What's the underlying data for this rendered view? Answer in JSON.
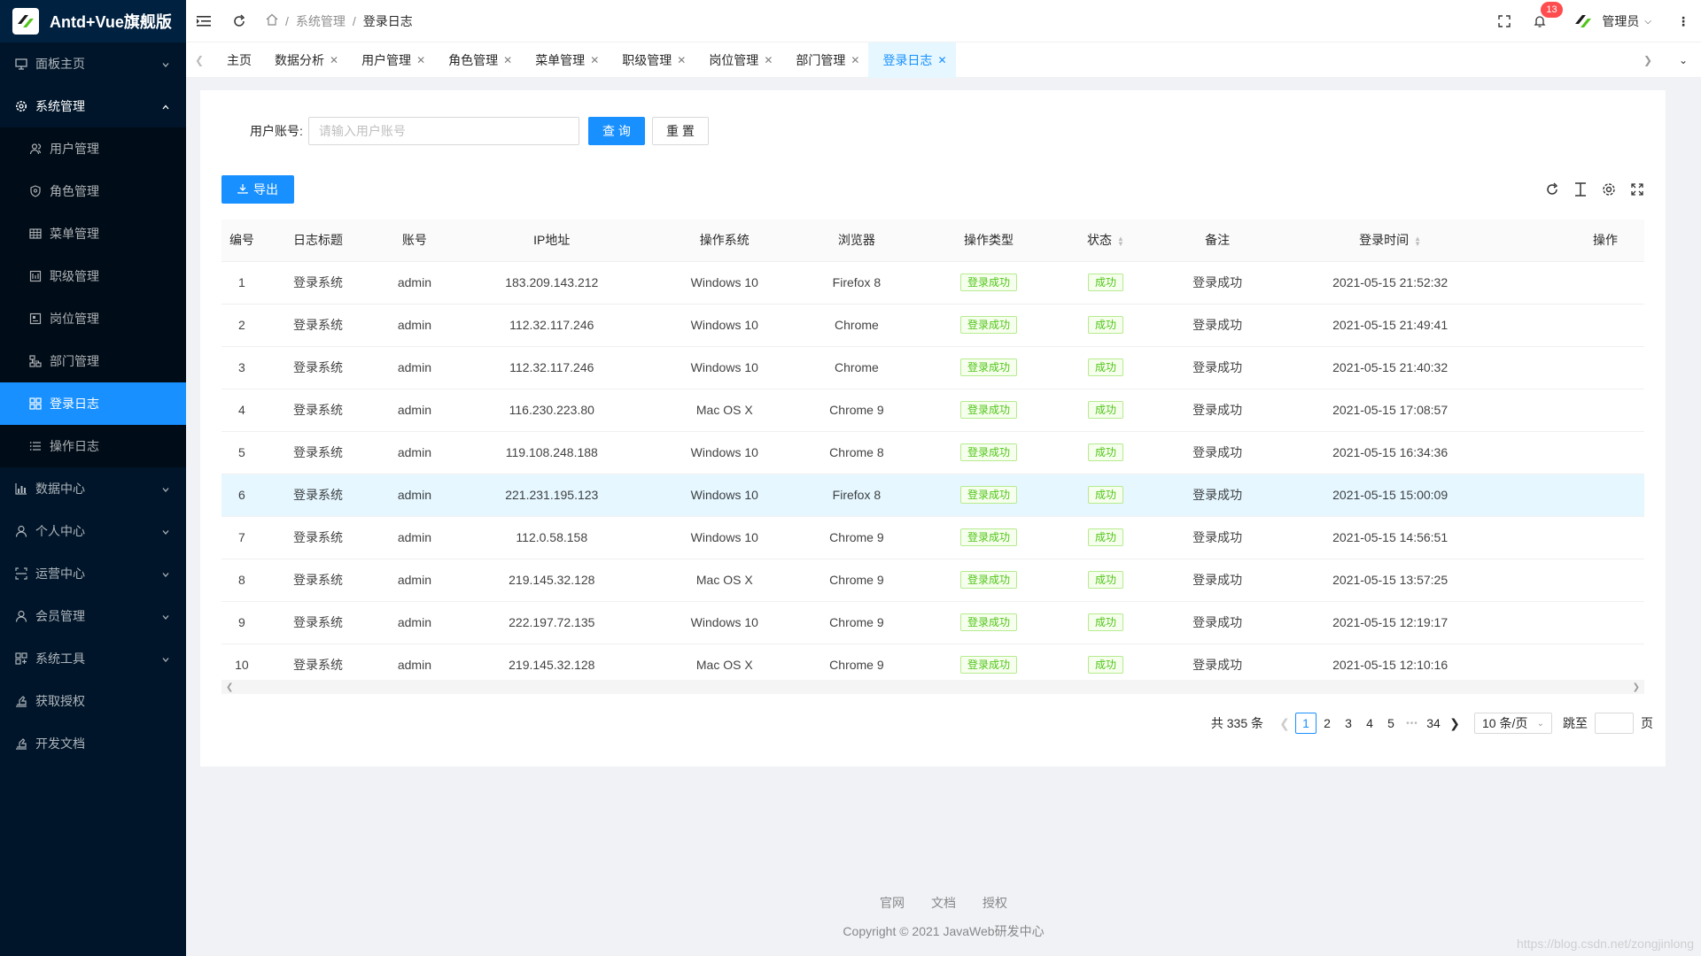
{
  "app": {
    "title": "Antd+Vue旗舰版"
  },
  "sidebar": {
    "items": [
      {
        "label": "面板主页",
        "icon": "monitor-icon",
        "has_children": true
      },
      {
        "label": "系统管理",
        "icon": "gear-icon",
        "has_children": true,
        "open": true,
        "children": [
          {
            "label": "用户管理",
            "icon": "user-group-icon"
          },
          {
            "label": "角色管理",
            "icon": "shield-icon"
          },
          {
            "label": "菜单管理",
            "icon": "grid-icon"
          },
          {
            "label": "职级管理",
            "icon": "rank-icon"
          },
          {
            "label": "岗位管理",
            "icon": "post-icon"
          },
          {
            "label": "部门管理",
            "icon": "org-icon"
          },
          {
            "label": "登录日志",
            "icon": "app-grid-icon",
            "active": true
          },
          {
            "label": "操作日志",
            "icon": "list-icon"
          }
        ]
      },
      {
        "label": "数据中心",
        "icon": "chart-icon",
        "has_children": true
      },
      {
        "label": "个人中心",
        "icon": "person-icon",
        "has_children": true
      },
      {
        "label": "运营中心",
        "icon": "scan-icon",
        "has_children": true
      },
      {
        "label": "会员管理",
        "icon": "member-icon",
        "has_children": true
      },
      {
        "label": "系统工具",
        "icon": "tools-icon",
        "has_children": true
      },
      {
        "label": "获取授权",
        "icon": "auth-icon",
        "has_children": false
      },
      {
        "label": "开发文档",
        "icon": "doc-icon",
        "has_children": false
      }
    ]
  },
  "header": {
    "breadcrumb": [
      "系统管理",
      "登录日志"
    ],
    "notification_count": "13",
    "user_name": "管理员"
  },
  "tabs": [
    {
      "label": "主页",
      "closable": false
    },
    {
      "label": "数据分析",
      "closable": true
    },
    {
      "label": "用户管理",
      "closable": true
    },
    {
      "label": "角色管理",
      "closable": true
    },
    {
      "label": "菜单管理",
      "closable": true
    },
    {
      "label": "职级管理",
      "closable": true
    },
    {
      "label": "岗位管理",
      "closable": true
    },
    {
      "label": "部门管理",
      "closable": true
    },
    {
      "label": "登录日志",
      "closable": true,
      "active": true
    }
  ],
  "search": {
    "label": "用户账号:",
    "placeholder": "请输入用户账号",
    "query_label": "查 询",
    "reset_label": "重 置"
  },
  "export_label": "导出",
  "table": {
    "columns": [
      "编号",
      "日志标题",
      "账号",
      "IP地址",
      "操作系统",
      "浏览器",
      "操作类型",
      "状态",
      "备注",
      "登录时间",
      "操作"
    ],
    "rows": [
      [
        "1",
        "登录系统",
        "admin",
        "183.209.143.212",
        "Windows 10",
        "Firefox 8",
        "登录成功",
        "成功",
        "登录成功",
        "2021-05-15 21:52:32"
      ],
      [
        "2",
        "登录系统",
        "admin",
        "112.32.117.246",
        "Windows 10",
        "Chrome",
        "登录成功",
        "成功",
        "登录成功",
        "2021-05-15 21:49:41"
      ],
      [
        "3",
        "登录系统",
        "admin",
        "112.32.117.246",
        "Windows 10",
        "Chrome",
        "登录成功",
        "成功",
        "登录成功",
        "2021-05-15 21:40:32"
      ],
      [
        "4",
        "登录系统",
        "admin",
        "116.230.223.80",
        "Mac OS X",
        "Chrome 9",
        "登录成功",
        "成功",
        "登录成功",
        "2021-05-15 17:08:57"
      ],
      [
        "5",
        "登录系统",
        "admin",
        "119.108.248.188",
        "Windows 10",
        "Chrome 8",
        "登录成功",
        "成功",
        "登录成功",
        "2021-05-15 16:34:36"
      ],
      [
        "6",
        "登录系统",
        "admin",
        "221.231.195.123",
        "Windows 10",
        "Firefox 8",
        "登录成功",
        "成功",
        "登录成功",
        "2021-05-15 15:00:09"
      ],
      [
        "7",
        "登录系统",
        "admin",
        "112.0.58.158",
        "Windows 10",
        "Chrome 9",
        "登录成功",
        "成功",
        "登录成功",
        "2021-05-15 14:56:51"
      ],
      [
        "8",
        "登录系统",
        "admin",
        "219.145.32.128",
        "Mac OS X",
        "Chrome 9",
        "登录成功",
        "成功",
        "登录成功",
        "2021-05-15 13:57:25"
      ],
      [
        "9",
        "登录系统",
        "admin",
        "222.197.72.135",
        "Windows 10",
        "Chrome 9",
        "登录成功",
        "成功",
        "登录成功",
        "2021-05-15 12:19:17"
      ],
      [
        "10",
        "登录系统",
        "admin",
        "219.145.32.128",
        "Mac OS X",
        "Chrome 9",
        "登录成功",
        "成功",
        "登录成功",
        "2021-05-15 12:10:16"
      ]
    ],
    "hover_row": 5
  },
  "pagination": {
    "total_text": "共 335 条",
    "pages": [
      "1",
      "2",
      "3",
      "4",
      "5",
      "•••",
      "34"
    ],
    "current": "1",
    "page_size": "10 条/页",
    "jump_prefix": "跳至",
    "jump_suffix": "页"
  },
  "footer": {
    "links": [
      "官网",
      "文档",
      "授权"
    ],
    "copyright": "Copyright © 2021 JavaWeb研发中心"
  },
  "watermark": "https://blog.csdn.net/zongjinlong",
  "colors": {
    "primary": "#1890ff",
    "sidebar_bg": "#001529",
    "success": "#52c41a"
  }
}
